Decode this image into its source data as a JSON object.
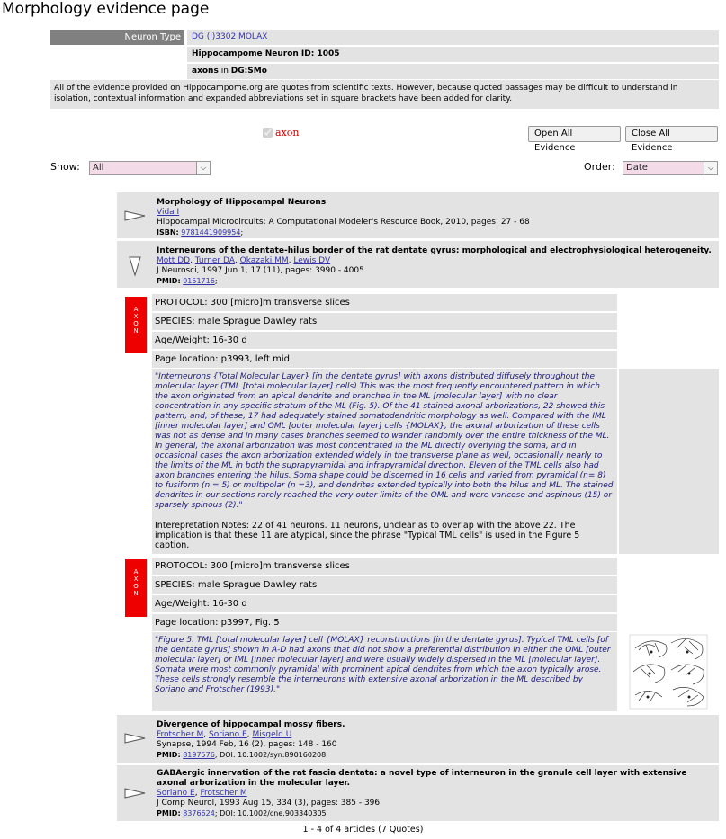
{
  "page_title": "Morphology evidence page",
  "info": {
    "neuron_type_label": "Neuron Type",
    "neuron_type_link": "DG (i)3302 MOLAX",
    "neuron_id": "Hippocampome Neuron ID: 1005",
    "location_prefix": "axons",
    "location_in": "in",
    "location_value": "DG:SMo"
  },
  "notice": "All of the evidence provided on Hippocampome.org are quotes from scientific texts. However, because quoted passages may be difficult to understand in isolation, contextual information and expanded abbreviations set in square brackets have been added for clarity.",
  "filter": {
    "axon_label": "axon",
    "open_all": "Open All Evidence",
    "close_all": "Close All Evidence",
    "show_label": "Show:",
    "show_value": "All",
    "order_label": "Order:",
    "order_value": "Date"
  },
  "articles": [
    {
      "title": "Morphology of Hippocampal Neurons",
      "authors": [
        "Vida I"
      ],
      "journal": "Hippocampal Microcircuits: A Computational Modeler's Resource Book, 2010, pages: 27 - 68",
      "id_label": "ISBN:",
      "id_value": "9781441909954",
      "doi": "",
      "expanded": false
    },
    {
      "title": "Interneurons of the dentate-hilus border of the rat dentate gyrus: morphological and electrophysiological heterogeneity.",
      "authors": [
        "Mott DD",
        "Turner DA",
        "Okazaki MM",
        "Lewis DV"
      ],
      "journal": "J Neurosci, 1997 Jun 1, 17 (11), pages: 3990 - 4005",
      "id_label": "PMID:",
      "id_value": "9151716",
      "doi": "",
      "expanded": true
    },
    {
      "title": "Divergence of hippocampal mossy fibers.",
      "authors": [
        "Frotscher M",
        "Soriano E",
        "Misgeld U"
      ],
      "journal": "Synapse, 1994 Feb, 16 (2), pages: 148 - 160",
      "id_label": "PMID:",
      "id_value": "8197576",
      "doi": "; DOI: 10.1002/syn.890160208",
      "expanded": false
    },
    {
      "title": "GABAergic innervation of the rat fascia dentata: a novel type of interneuron in the granule cell layer with extensive axonal arborization in the molecular layer.",
      "authors": [
        "Soriano E",
        "Frotscher M"
      ],
      "journal": "J Comp Neurol, 1993 Aug 15, 334 (3), pages: 385 - 396",
      "id_label": "PMID:",
      "id_value": "8376624",
      "doi": "; DOI: 10.1002/cne.903340305",
      "expanded": false
    }
  ],
  "quotes": [
    {
      "tag": "AXON",
      "protocol": "PROTOCOL: 300 [micro]m transverse slices",
      "species": "SPECIES: male Sprague Dawley rats",
      "age": "Age/Weight: 16-30 d",
      "page_location": "Page location: p3993, left mid",
      "text": "\"Interneurons {Total Molecular Layer} [in the dentate gyrus] with axons distributed diffusely throughout the molecular layer (TML [total molecular layer] cells) This was the most frequently encountered pattern in which the axon originated from an apical dendrite and branched in the ML [molecular layer] with no clear concentration in any specific stratum of the ML (Fig. 5). Of the 41 stained axonal arborizations, 22 showed this pattern, and, of these, 17 had adequately stained somatodendritic morphology as well. Compared with the IML [inner molecular layer] and OML [outer molecular layer] cells {MOLAX}, the axonal arborization of these cells was not as dense and in many cases branches seemed to wander randomly over the entire thickness of the ML. In general, the axonal arborization was most concentrated in the ML directly overlying the soma, and in occasional cases the axon arborization extended widely in the transverse plane as well, occasionally nearly to the limits of the ML in both the suprapyramidal and infrapyramidal direction. Eleven of the TML cells also had axon branches entering the hilus. Soma shape could be discerned in 16 cells and varied from pyramidal (n= 8) to fusiform (n = 5) or multipolar (n =3), and dendrites extended typically into both the hilus and ML. The stained dendrites in our sections rarely reached the very outer limits of the OML and were varicose and aspinous (15) or sparsely spinous (2).\"",
      "notes": "Interepretation Notes: 22 of 41 neurons. 11 neurons, unclear as to overlap with the above 22. The implication is that these 11 are atypical, since the phrase \"Typical TML cells\" is used in the Figure 5 caption."
    },
    {
      "tag": "AXON",
      "protocol": "PROTOCOL: 300 [micro]m transverse slices",
      "species": "SPECIES: male Sprague Dawley rats",
      "age": "Age/Weight: 16-30 d",
      "page_location": "Page location: p3997, Fig. 5",
      "text": "\"Figure 5. TML [total molecular layer] cell {MOLAX} reconstructions [in the dentate gyrus]. Typical TML cells [of the dentate gyrus] shown in A-D had axons that did not show a preferential distribution in either the OML [outer molecular layer] or IML [inner molecular layer] and were usually widely dispersed in the ML [molecular layer]. Somata were most commonly pyramidal with prominent apical dendrites from which the axon typically arose. These cells strongly resemble the interneurons with extensive axonal arborization in the ML described by Soriano and Frotscher (1993).\"",
      "notes": ""
    }
  ],
  "footer": "1 - 4 of 4 articles (7 Quotes)",
  "colors": {
    "axon_tag": "#ee0000",
    "panel": "#e3e3e3",
    "label_bg": "#808080",
    "link": "#3333aa"
  }
}
